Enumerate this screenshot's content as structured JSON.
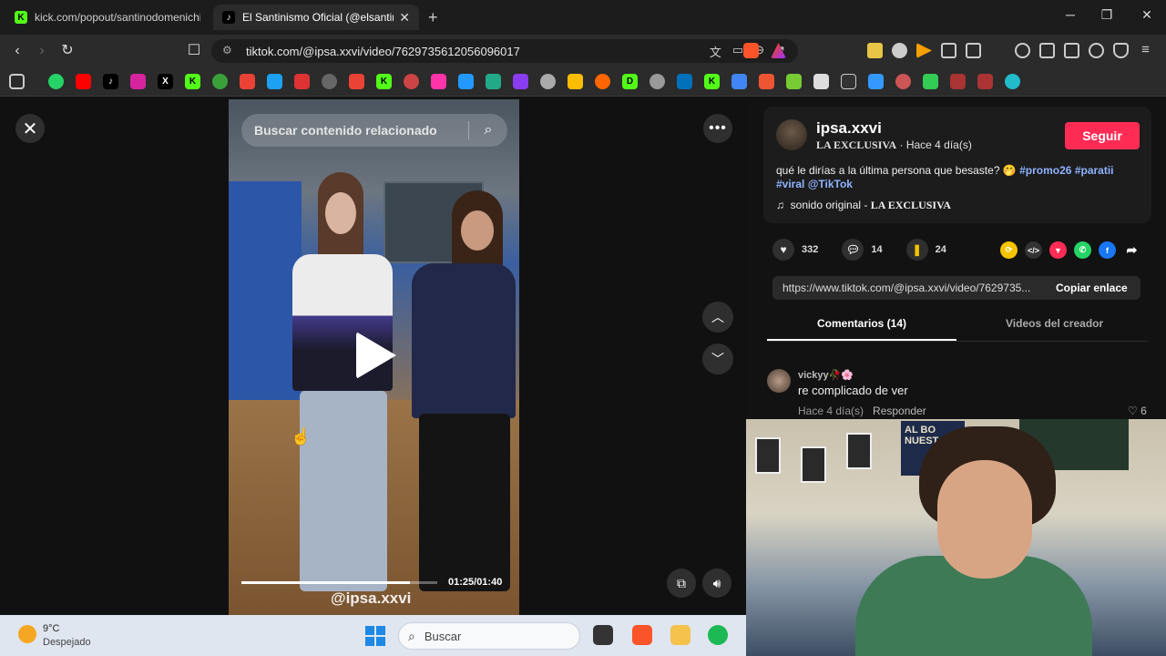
{
  "browser": {
    "tabs": [
      {
        "title": "kick.com/popout/santinodomenichini",
        "favicon": "K",
        "active": false
      },
      {
        "title": "El Santinismo Oficial (@elsantini",
        "favicon": "♪",
        "active": true
      }
    ],
    "url": "tiktok.com/@ipsa.xxvi/video/7629735612056096017",
    "new_tab": "+",
    "window": {
      "minimize": "─",
      "maximize": "❐",
      "close": "✕"
    }
  },
  "video": {
    "search_placeholder": "Buscar contenido relacionado",
    "progress": 0.86,
    "timecode": "01:25/01:40",
    "watermark": "@ipsa.xxvi"
  },
  "post": {
    "username": "ipsa.xxvi",
    "display_name": "LA EXCLUSIVA",
    "posted": " · Hace 4 día(s)",
    "follow_label": "Seguir",
    "caption_text": "qué le dirías a la última persona que besaste? 🤭 ",
    "hashtags": [
      "#promo26",
      "#paratii",
      "#viral",
      "@TikTok"
    ],
    "sound_prefix": "sonido original - ",
    "sound_name": "LA EXCLUSIVA",
    "likes": "332",
    "comments": "14",
    "saves": "24",
    "share_link": "https://www.tiktok.com/@ipsa.xxvi/video/7629735...",
    "copy_label": "Copiar enlace",
    "tab_comments": "Comentarios (14)",
    "tab_creator": "Videos del creador"
  },
  "comments": [
    {
      "user": "vickyy🥀🌸",
      "text": "re complicado de ver",
      "time": "Hace 4 día(s)",
      "reply": "Responder",
      "likes": "6"
    }
  ],
  "webcam": {
    "banner": "AL BO NUEST EL"
  },
  "taskbar": {
    "temperature": "9°C",
    "condition": "Despejado",
    "search_label": "Buscar"
  },
  "colors": {
    "follow": "#fe2c55",
    "hashtag": "#8fb3ff"
  }
}
